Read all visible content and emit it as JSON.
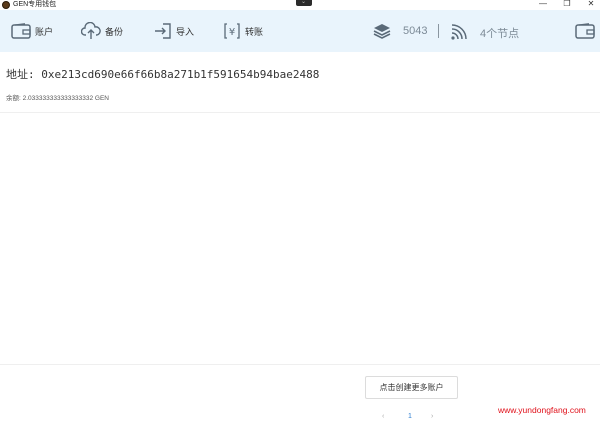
{
  "window": {
    "title": "GEN专用钱包",
    "controls": {
      "minimize": "—",
      "maximize": "❐",
      "close": "✕"
    }
  },
  "toolbar": {
    "account_label": "账户",
    "backup_label": "备份",
    "import_label": "导入",
    "transfer_label": "转账",
    "block_height": "5043",
    "nodes_label": "4个节点"
  },
  "wallet": {
    "address_line": "地址: 0xe213cd690e66f66b8a271b1f591654b94bae2488",
    "balance_line": "余额: 2.033333333333333332 GEN"
  },
  "footer": {
    "more_accounts_button": "点击创建更多账户",
    "pagination": {
      "prev": "‹",
      "current": "1",
      "next": "›"
    }
  },
  "watermark": "www.yundongfang.com",
  "colors": {
    "toolbar_bg": "#e9f4fc",
    "icon": "#5a6a78",
    "page_current": "#2f7fd1",
    "watermark": "#e0101a"
  }
}
